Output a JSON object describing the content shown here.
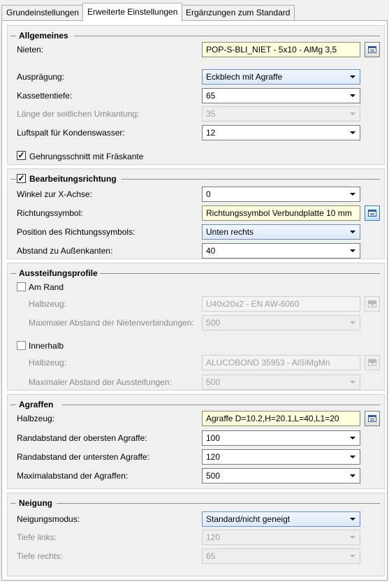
{
  "tabs": [
    {
      "label": "Grundeinstellungen",
      "active": false
    },
    {
      "label": "Erweiterte Einstellungen",
      "active": true
    },
    {
      "label": "Ergänzungen zum Standard",
      "active": false
    }
  ],
  "allgemeines": {
    "title": "Allgemeines",
    "nieten_label": "Nieten:",
    "nieten_value": "POP-S-BLI_NIET -  5x10 - AlMg 3,5",
    "auspraegung_label": "Ausprägung:",
    "auspraegung_value": "Eckblech mit Agraffe",
    "kassettentiefe_label": "Kassettentiefe:",
    "kassettentiefe_value": "65",
    "laenge_label": "Länge der seitlichen Umkantung:",
    "laenge_value": "35",
    "luftspalt_label": "Luftspalt für Kondenswasser:",
    "luftspalt_value": "12",
    "gehrung_label": "Gehrungsschnitt mit Fräskante",
    "gehrung_checked": true
  },
  "bearbeitung": {
    "title": "Bearbeitungsrichtung",
    "checked": true,
    "winkel_label": "Winkel zur X-Achse:",
    "winkel_value": "0",
    "symbol_label": "Richtungssymbol:",
    "symbol_value": "Richtungssymbol Verbundplatte 10 mm",
    "position_label": "Position des Richtungssymbols:",
    "position_value": "Unten rechts",
    "abstand_label": "Abstand zu Außenkanten:",
    "abstand_value": "40"
  },
  "aussteifung": {
    "title": "Aussteifungsprofile",
    "rand_label": "Am Rand",
    "rand_checked": false,
    "rand_halbzeug_label": "Halbzeug:",
    "rand_halbzeug_value": "U40x20x2 - EN AW-6060",
    "rand_abstand_label": "Maximaler Abstand der Nietenverbindungen:",
    "rand_abstand_value": "500",
    "innen_label": "Innerhalb",
    "innen_checked": false,
    "innen_halbzeug_label": "Halbzeug:",
    "innen_halbzeug_value": "ALUCOBOND 35953 - AlSiMgMn",
    "innen_abstand_label": "Maximaler Abstand der Aussteifungen:",
    "innen_abstand_value": "500"
  },
  "agraffen": {
    "title": "Agraffen",
    "halbzeug_label": "Halbzeug:",
    "halbzeug_value": "Agraffe D=10.2,H=20.1,L=40,L1=20",
    "oben_label": "Randabstand der obersten Agraffe:",
    "oben_value": "100",
    "unten_label": "Randabstand der untersten Agraffe:",
    "unten_value": "120",
    "max_label": "Maximalabstand der Agraffen:",
    "max_value": "500"
  },
  "neigung": {
    "title": "Neigung",
    "modus_label": "Neigungsmodus:",
    "modus_value": "Standard/nicht geneigt",
    "links_label": "Tiefe links:",
    "links_value": "120",
    "rechts_label": "Tiefe rechts:",
    "rechts_value": "65"
  },
  "icons": {
    "browse": "catalog-list-icon",
    "dropdown": "chevron-down-icon",
    "check": "checkmark-icon"
  }
}
